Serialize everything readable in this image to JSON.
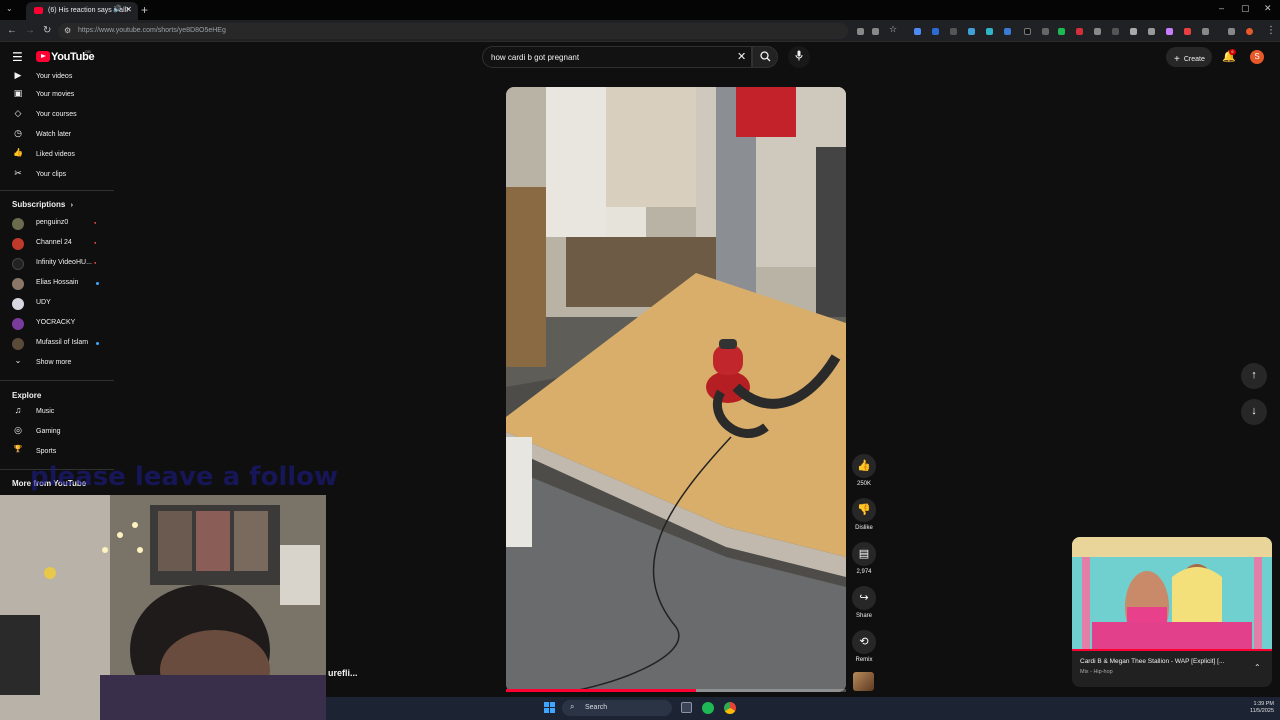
{
  "browser": {
    "tab_title": "(6) His reaction says it all! ",
    "new_tab_symbol": "+",
    "url": "https://www.youtube.com/shorts/ye8D8O5eHEg",
    "window_controls": [
      "–",
      "▢",
      "✕"
    ]
  },
  "youtube": {
    "logo_text": "YouTube",
    "country_code": "GB",
    "search_query": "how cardi b got pregnant",
    "create_label": "Create",
    "notifications_count": "6",
    "avatar_letter": "S"
  },
  "sidebar": {
    "top_items": [
      {
        "label": "Your videos",
        "icon": "video-icon",
        "glyph": "▶"
      },
      {
        "label": "Your movies",
        "icon": "movies-icon",
        "glyph": "▣"
      },
      {
        "label": "Your courses",
        "icon": "courses-icon",
        "glyph": "◇"
      },
      {
        "label": "Watch later",
        "icon": "clock-icon",
        "glyph": "◷"
      },
      {
        "label": "Liked videos",
        "icon": "thumb-up-icon",
        "glyph": "👍"
      },
      {
        "label": "Your clips",
        "icon": "scissors-icon",
        "glyph": "✂"
      }
    ],
    "subscriptions_heading": "Subscriptions",
    "subscriptions": [
      {
        "label": "penguinz0",
        "avatar_color": "#6b6b4e",
        "status": "live"
      },
      {
        "label": "Channel 24",
        "avatar_color": "#c0392b",
        "status": "live"
      },
      {
        "label": "Infinity VideoHU...",
        "avatar_color": "#222222",
        "status": "live"
      },
      {
        "label": "Elias Hossain",
        "avatar_color": "#8a7766",
        "status": "dot"
      },
      {
        "label": "UDY",
        "avatar_color": "#d8d8e0",
        "status": ""
      },
      {
        "label": "YOCRACKY",
        "avatar_color": "#7a3b9e",
        "status": ""
      },
      {
        "label": "Mufassil of Islam",
        "avatar_color": "#5a4a3a",
        "status": "dot"
      }
    ],
    "show_more": "Show more",
    "explore_heading": "Explore",
    "explore_items": [
      {
        "label": "Music",
        "icon": "music-icon",
        "glyph": "♫"
      },
      {
        "label": "Gaming",
        "icon": "gaming-icon",
        "glyph": "◎"
      },
      {
        "label": "Sports",
        "icon": "trophy-icon",
        "glyph": "🏆"
      }
    ],
    "more_heading": "More from YouTube",
    "live_marker": "●"
  },
  "short": {
    "progress_fraction": 0.56,
    "actions": [
      {
        "name": "like-button",
        "icon": "thumb-up-icon",
        "glyph": "👍",
        "caption": "250K"
      },
      {
        "name": "dislike-button",
        "icon": "thumb-down-icon",
        "glyph": "👎",
        "caption": "Dislike"
      },
      {
        "name": "comments-button",
        "icon": "comment-icon",
        "glyph": "▤",
        "caption": "2,974"
      },
      {
        "name": "share-button",
        "icon": "share-icon",
        "glyph": "↪",
        "caption": "Share"
      },
      {
        "name": "remix-button",
        "icon": "remix-icon",
        "glyph": "⟲",
        "caption": "Remix"
      }
    ],
    "nav_up_glyph": "↑",
    "nav_down_glyph": "↓"
  },
  "miniplayer": {
    "title": "Cardi B & Megan Thee Stallion - WAP [Explicit] [...",
    "subtitle": "Mix - Hip-hop",
    "expand_glyph": "⌃"
  },
  "overlay": {
    "follow_text": "please leave a follow",
    "cut_label": "urefli..."
  },
  "taskbar": {
    "search_label": "Search",
    "time": "1:39 PM",
    "date": "11/5/2025"
  }
}
